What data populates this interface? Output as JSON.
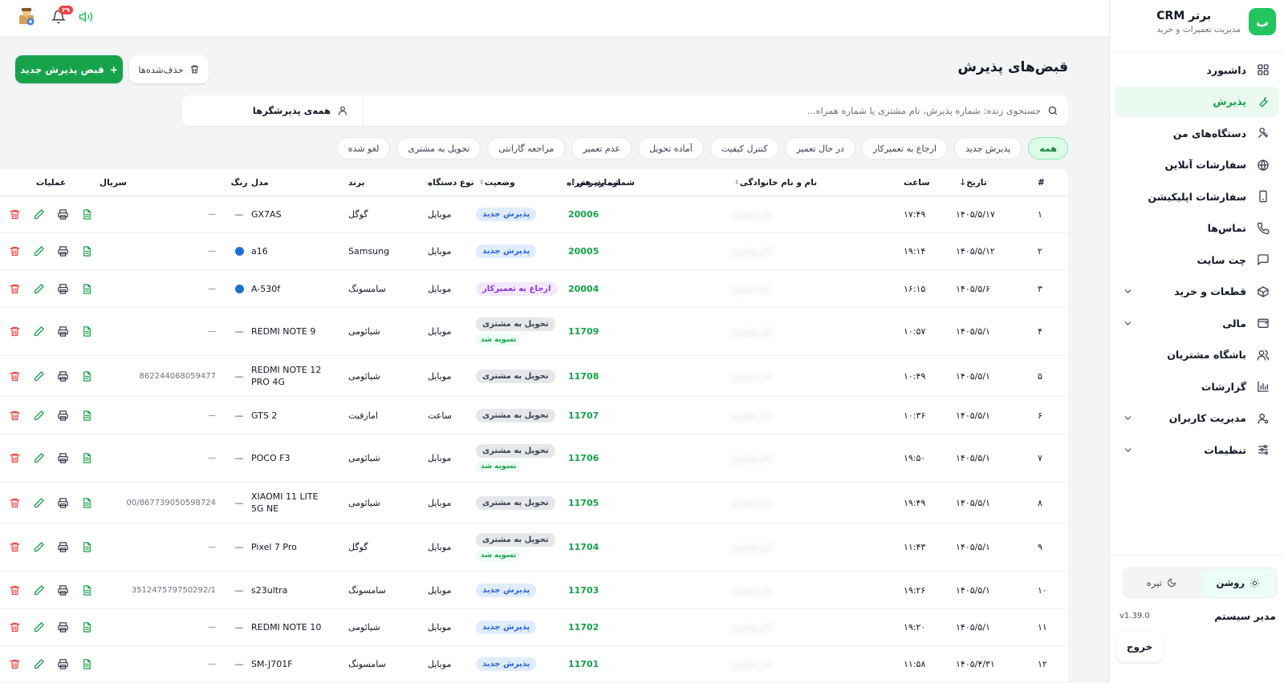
{
  "brand": {
    "logo_letter": "ب",
    "title": "برتر CRM",
    "subtitle": "مدیریت تعمیرات و خرید"
  },
  "sidebar": {
    "items": [
      {
        "label": "داشبورد",
        "icon": "dashboard-icon"
      },
      {
        "label": "پذیرش",
        "icon": "wrench-icon",
        "active": true
      },
      {
        "label": "دستگاه‌های من",
        "icon": "tools-icon"
      },
      {
        "label": "سفارشات آنلاین",
        "icon": "globe-icon"
      },
      {
        "label": "سفارشات اپلیکیشن",
        "icon": "phone-icon"
      },
      {
        "label": "تماس‌ها",
        "icon": "call-icon"
      },
      {
        "label": "چت سایت",
        "icon": "chat-icon"
      },
      {
        "label": "قطعات و خرید",
        "icon": "box-icon",
        "expandable": true
      },
      {
        "label": "مالی",
        "icon": "wallet-icon",
        "expandable": true
      },
      {
        "label": "باشگاه مشتریان",
        "icon": "users-icon"
      },
      {
        "label": "گزارشات",
        "icon": "chart-icon"
      },
      {
        "label": "مدیریت کاربران",
        "icon": "user-cog-icon",
        "expandable": true
      },
      {
        "label": "تنظیمات",
        "icon": "settings-icon",
        "expandable": true
      }
    ],
    "theme": {
      "light": "روشن",
      "dark": "تیره"
    },
    "admin_name": "مدیر سیستم",
    "version": "v1.39.0",
    "logout": "خروج"
  },
  "topbar": {
    "notification_count": "۲۹"
  },
  "page": {
    "title": "قبض‌های پذیرش",
    "new_button": "قبض پذیرش جدید",
    "trash_button": "حذف‌شده‌ها",
    "search_placeholder": "جستجوی زنده: شماره پذیرش، نام مشتری یا شماره همراه...",
    "receivers_filter": "همه‌ی پذیرشگرها"
  },
  "filters": [
    "همه",
    "پذیرش جدید",
    "ارجاع به تعمیرکار",
    "در حال تعمیر",
    "کنترل کیفیت",
    "آماده تحویل",
    "عدم تعمیر",
    "مراجعه گارانتی",
    "تحویل به مشتری",
    "لغو شده"
  ],
  "table": {
    "headers": {
      "idx": "#",
      "date": "تاریخ",
      "time": "ساعت",
      "name": "نام و نام خانوادگی",
      "phone": "شماره همراه",
      "recno": "شماره پذیرش",
      "status": "وضعیت",
      "type": "نوع دستگاه",
      "brand": "برند",
      "model": "مدل",
      "color": "رنگ",
      "serial": "سریال",
      "ops": "عملیات"
    },
    "blurred_name": "نام مشتری",
    "blurred_phone": "۰۹۱۲۰۰۰۰۰۰۰",
    "status_colors": {
      "new": "#2563eb",
      "referral": "#9333ea",
      "delivered": "#374151",
      "settled": "#16a34a"
    },
    "device_color_hex": "#1d6fd8",
    "rows": [
      {
        "idx": "۱",
        "date": "۱۴۰۵/۵/۱۷",
        "time": "۱۷:۴۹",
        "recno": "20006",
        "status": "پذیرش جدید",
        "status_type": "new",
        "settled": "",
        "type": "موبایل",
        "brand": "گوگل",
        "model": "GX7AS",
        "color": "",
        "serial": "—"
      },
      {
        "idx": "۲",
        "date": "۱۴۰۵/۵/۱۲",
        "time": "۱۹:۱۴",
        "recno": "20005",
        "status": "پذیرش جدید",
        "status_type": "new",
        "settled": "",
        "type": "موبایل",
        "brand": "Samsung",
        "model": "a16",
        "color": "blue",
        "serial": "—"
      },
      {
        "idx": "۳",
        "date": "۱۴۰۵/۵/۶",
        "time": "۱۶:۱۵",
        "recno": "20004",
        "status": "ارجاع به تعمیرکار",
        "status_type": "referral",
        "settled": "",
        "type": "موبایل",
        "brand": "سامسونگ",
        "model": "A-530f",
        "color": "blue",
        "serial": "—"
      },
      {
        "idx": "۴",
        "date": "۱۴۰۵/۵/۱",
        "time": "۱۰:۵۷",
        "recno": "11709",
        "status": "تحویل به مشتری",
        "status_type": "delivered",
        "settled": "تسویه شد",
        "type": "موبایل",
        "brand": "شیائومی",
        "model": "REDMI NOTE 9",
        "color": "",
        "serial": "—"
      },
      {
        "idx": "۵",
        "date": "۱۴۰۵/۵/۱",
        "time": "۱۰:۴۹",
        "recno": "11708",
        "status": "تحویل به مشتری",
        "status_type": "delivered",
        "settled": "",
        "type": "موبایل",
        "brand": "شیائومی",
        "model": "REDMI NOTE 12 PRO 4G",
        "color": "",
        "serial": "862244068059477"
      },
      {
        "idx": "۶",
        "date": "۱۴۰۵/۵/۱",
        "time": "۱۰:۳۶",
        "recno": "11707",
        "status": "تحویل به مشتری",
        "status_type": "delivered",
        "settled": "",
        "type": "ساعت",
        "brand": "امازفیت",
        "model": "GTS 2",
        "color": "",
        "serial": "—"
      },
      {
        "idx": "۷",
        "date": "۱۴۰۵/۵/۱",
        "time": "۱۹:۵۰",
        "recno": "11706",
        "status": "تحویل به مشتری",
        "status_type": "delivered",
        "settled": "تسویه شد",
        "type": "موبایل",
        "brand": "شیائومی",
        "model": "POCO F3",
        "color": "",
        "serial": "—"
      },
      {
        "idx": "۸",
        "date": "۱۴۰۵/۵/۱",
        "time": "۱۹:۴۹",
        "recno": "11705",
        "status": "تحویل به مشتری",
        "status_type": "delivered",
        "settled": "",
        "type": "موبایل",
        "brand": "شیائومی",
        "model": "XIAOMI 11 LITE 5G NE",
        "color": "",
        "serial": "00/867739050598724"
      },
      {
        "idx": "۹",
        "date": "۱۴۰۵/۵/۱",
        "time": "۱۱:۴۳",
        "recno": "11704",
        "status": "تحویل به مشتری",
        "status_type": "delivered",
        "settled": "تسویه شد",
        "type": "موبایل",
        "brand": "گوگل",
        "model": "Pixel 7 Pro",
        "color": "",
        "serial": "—"
      },
      {
        "idx": "۱۰",
        "date": "۱۴۰۵/۵/۱",
        "time": "۱۹:۲۶",
        "recno": "11703",
        "status": "پذیرش جدید",
        "status_type": "new",
        "settled": "",
        "type": "موبایل",
        "brand": "سامسونگ",
        "model": "s23ultra",
        "color": "",
        "serial": "351247579750292/1"
      },
      {
        "idx": "۱۱",
        "date": "۱۴۰۵/۵/۱",
        "time": "۱۹:۲۰",
        "recno": "11702",
        "status": "پذیرش جدید",
        "status_type": "new",
        "settled": "",
        "type": "موبایل",
        "brand": "شیائومی",
        "model": "REDMI NOTE 10",
        "color": "",
        "serial": "—"
      },
      {
        "idx": "۱۲",
        "date": "۱۴۰۵/۴/۳۱",
        "time": "۱۱:۵۸",
        "recno": "11701",
        "status": "پذیرش جدید",
        "status_type": "new",
        "settled": "",
        "type": "موبایل",
        "brand": "سامسونگ",
        "model": "SM-J701F",
        "color": "",
        "serial": "—"
      }
    ]
  }
}
